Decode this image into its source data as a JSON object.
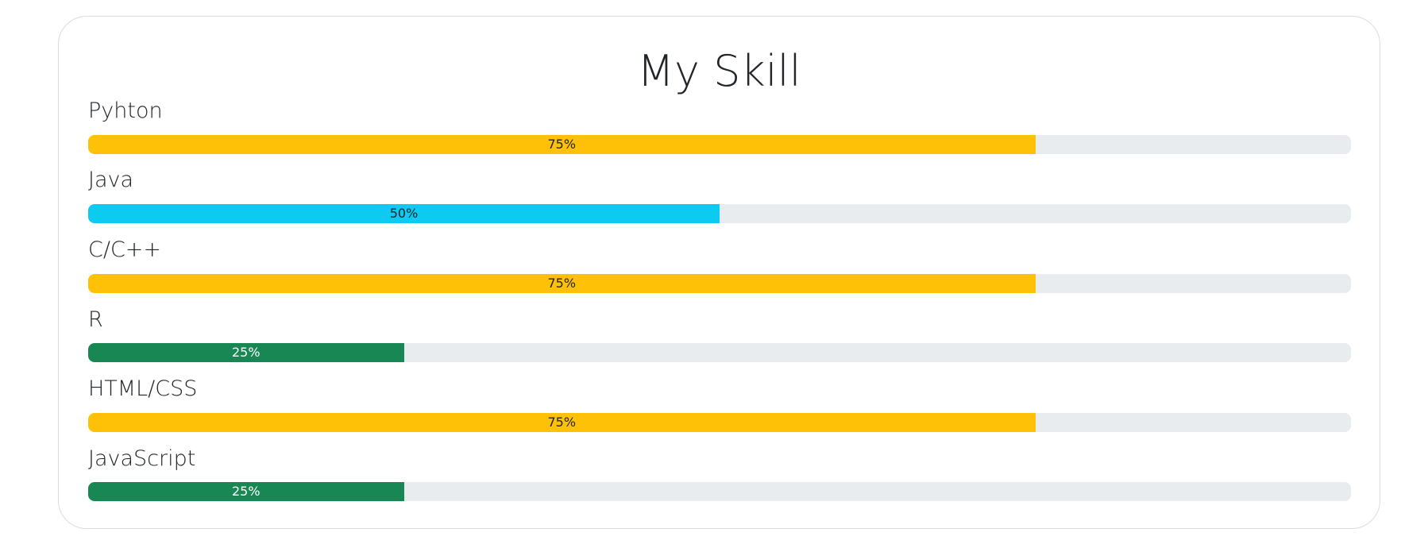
{
  "title": "My Skill",
  "skills": [
    {
      "label": "Pyhton",
      "percent": 75,
      "value_label": "75%",
      "color": "#ffc107",
      "text_color": "#212529"
    },
    {
      "label": "Java",
      "percent": 50,
      "value_label": "50%",
      "color": "#0dcaf0",
      "text_color": "#212529"
    },
    {
      "label": "C/C++",
      "percent": 75,
      "value_label": "75%",
      "color": "#ffc107",
      "text_color": "#212529"
    },
    {
      "label": "R",
      "percent": 25,
      "value_label": "25%",
      "color": "#198754",
      "text_color": "#ffffff"
    },
    {
      "label": "HTML/CSS",
      "percent": 75,
      "value_label": "75%",
      "color": "#ffc107",
      "text_color": "#212529"
    },
    {
      "label": "JavaScript",
      "percent": 25,
      "value_label": "25%",
      "color": "#198754",
      "text_color": "#ffffff"
    }
  ]
}
